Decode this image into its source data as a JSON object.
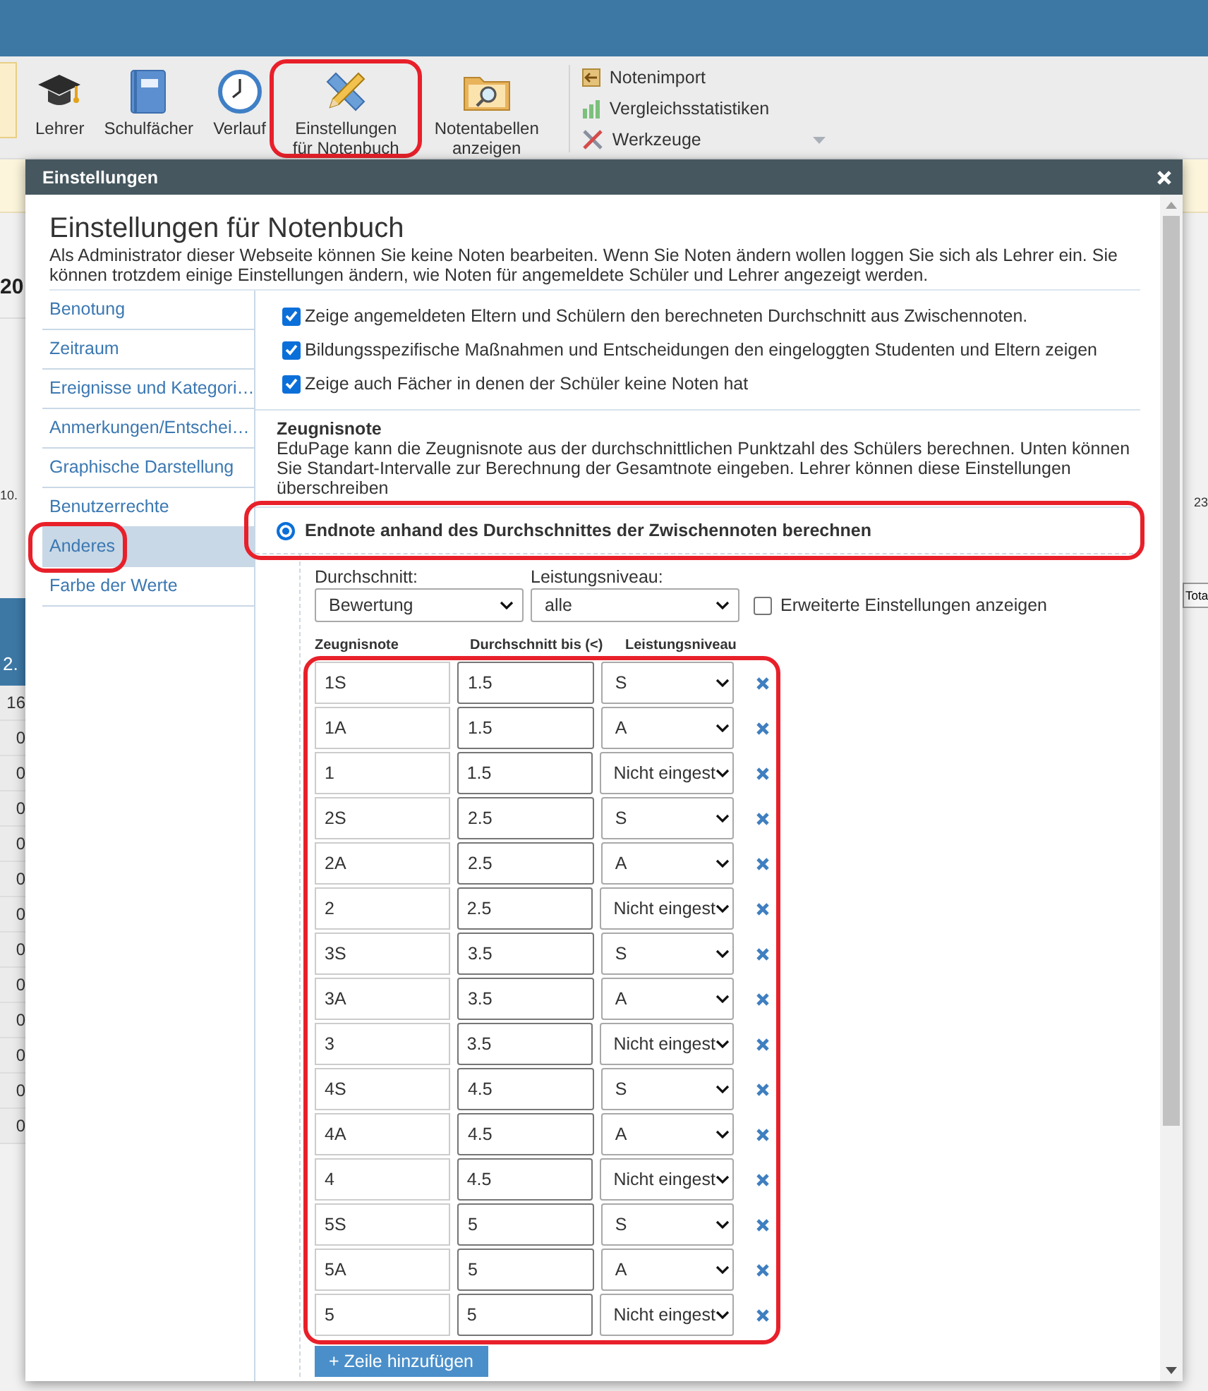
{
  "toolbar": {
    "items": [
      {
        "label": "Lehrer",
        "highlighted": false
      },
      {
        "label": "Schulfächer",
        "highlighted": false
      },
      {
        "label": "Verlauf",
        "highlighted": false
      },
      {
        "label": "Einstellungen\nfür Notenbuch",
        "highlighted": true
      },
      {
        "label": "Notentabellen\nanzeigen",
        "highlighted": false
      }
    ],
    "side_items": [
      {
        "label": "Notenimport",
        "dropdown": false
      },
      {
        "label": "Vergleichsstatistiken",
        "dropdown": false
      },
      {
        "label": "Werkzeuge",
        "dropdown": true
      }
    ]
  },
  "background": {
    "left": {
      "date": "20",
      "axis_label": "10.",
      "column_header": "2.",
      "cells": [
        "16",
        "0",
        "0",
        "0",
        "0",
        "0",
        "0",
        "0",
        "0",
        "0",
        "0",
        "0",
        "0"
      ]
    },
    "right": {
      "axis_label": "23",
      "button": "Tota"
    }
  },
  "dialog": {
    "title": "Einstellungen",
    "heading": "Einstellungen für Notenbuch",
    "description": "Als Administrator dieser Webseite können Sie keine Noten bearbeiten. Wenn Sie Noten ändern wollen loggen Sie sich als Lehrer ein. Sie können trotzdem einige Einstellungen ändern, wie Noten für angemeldete Schüler und Lehrer angezeigt werden.",
    "nav": [
      {
        "label": "Benotung",
        "selected": false,
        "highlighted": false
      },
      {
        "label": "Zeitraum",
        "selected": false,
        "highlighted": false
      },
      {
        "label": "Ereignisse und Kategori…",
        "selected": false,
        "highlighted": false
      },
      {
        "label": "Anmerkungen/Entschei…",
        "selected": false,
        "highlighted": false
      },
      {
        "label": "Graphische Darstellung",
        "selected": false,
        "highlighted": false
      },
      {
        "label": "Benutzerrechte",
        "selected": false,
        "highlighted": false
      },
      {
        "label": "Anderes",
        "selected": true,
        "highlighted": true
      },
      {
        "label": "Farbe der Werte",
        "selected": false,
        "highlighted": false
      }
    ],
    "checkboxes": [
      {
        "label": "Zeige angemeldeten Eltern und Schülern den berechneten Durchschnitt aus Zwischennoten.",
        "checked": true
      },
      {
        "label": "Bildungsspezifische Maßnahmen und Entscheidungen den eingeloggten Studenten und Eltern zeigen",
        "checked": true
      },
      {
        "label": "Zeige auch Fächer in denen der Schüler keine Noten hat",
        "checked": true
      }
    ],
    "section": {
      "title": "Zeugnisnote",
      "text": "EduPage kann die Zeugnisnote aus der durchschnittlichen Punktzahl des Schülers berechnen. Unten können Sie Standart-Intervalle zur Berechnung der Gesamtnote eingeben. Lehrer können diese Einstellungen überschreiben"
    },
    "radio": {
      "label": "Endnote anhand des Durchschnittes der Zwischennoten berechnen",
      "selected": true,
      "highlighted": true
    },
    "average_select": {
      "label": "Durchschnitt:",
      "value": "Bewertung"
    },
    "level_select": {
      "label": "Leistungsniveau:",
      "value": "alle"
    },
    "advanced_checkbox": {
      "label": "Erweiterte Einstellungen anzeigen",
      "checked": false
    },
    "grade_table": {
      "highlighted": true,
      "columns": [
        "Zeugnisnote",
        "Durchschnitt bis (<)",
        "Leistungsniveau"
      ],
      "rows": [
        {
          "grade": "1S",
          "average": "1.5",
          "level": "S"
        },
        {
          "grade": "1A",
          "average": "1.5",
          "level": "A"
        },
        {
          "grade": "1",
          "average": "1.5",
          "level": "Nicht eingest"
        },
        {
          "grade": "2S",
          "average": "2.5",
          "level": "S"
        },
        {
          "grade": "2A",
          "average": "2.5",
          "level": "A"
        },
        {
          "grade": "2",
          "average": "2.5",
          "level": "Nicht eingest"
        },
        {
          "grade": "3S",
          "average": "3.5",
          "level": "S"
        },
        {
          "grade": "3A",
          "average": "3.5",
          "level": "A"
        },
        {
          "grade": "3",
          "average": "3.5",
          "level": "Nicht eingest"
        },
        {
          "grade": "4S",
          "average": "4.5",
          "level": "S"
        },
        {
          "grade": "4A",
          "average": "4.5",
          "level": "A"
        },
        {
          "grade": "4",
          "average": "4.5",
          "level": "Nicht eingest"
        },
        {
          "grade": "5S",
          "average": "5",
          "level": "S"
        },
        {
          "grade": "5A",
          "average": "5",
          "level": "A"
        },
        {
          "grade": "5",
          "average": "5",
          "level": "Nicht eingest"
        }
      ]
    },
    "add_row_button": "+ Zeile hinzufügen"
  }
}
